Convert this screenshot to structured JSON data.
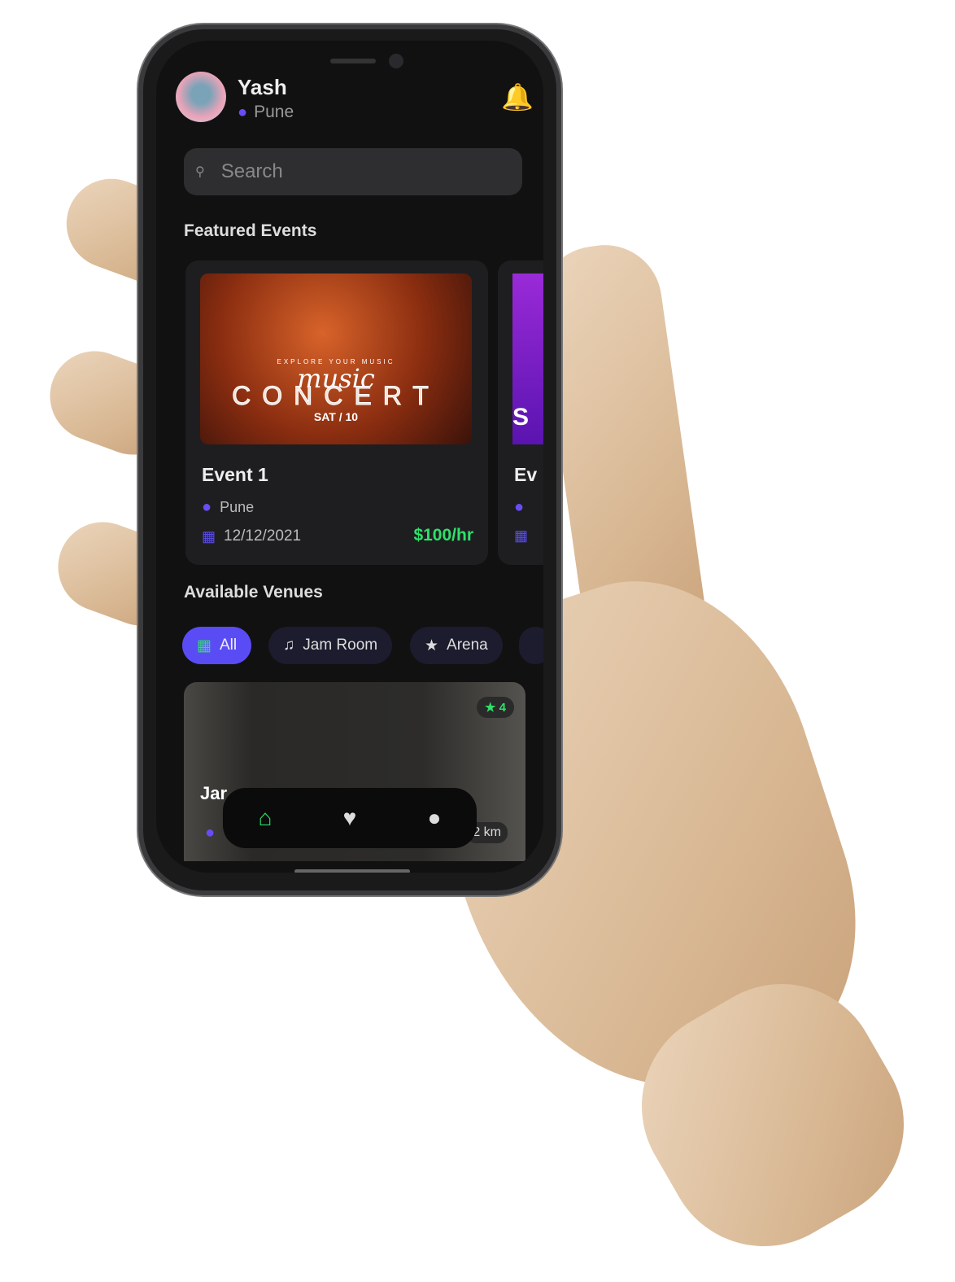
{
  "user": {
    "name": "Yash",
    "location": "Pune"
  },
  "search": {
    "placeholder": "Search"
  },
  "featured": {
    "title": "Featured Events",
    "events": [
      {
        "title": "Event 1",
        "location": "Pune",
        "date": "12/12/2021",
        "price": "$100/hr",
        "poster": {
          "tagline": "EXPLORE YOUR MUSIC",
          "script": "music",
          "headline": "CONCERT",
          "date": "SAT / 10"
        }
      },
      {
        "title": "Ev",
        "poster_letter": "S"
      }
    ]
  },
  "venues": {
    "title": "Available Venues",
    "filters": [
      {
        "label": "All",
        "icon": "grid-icon",
        "active": true
      },
      {
        "label": "Jam Room",
        "icon": "music-note-icon"
      },
      {
        "label": "Arena",
        "icon": "star-icon"
      }
    ],
    "items": [
      {
        "name": "Jar",
        "rating": "4",
        "distance": "2 km"
      }
    ]
  },
  "nav": {
    "items": [
      "home",
      "favorites",
      "profile"
    ],
    "active": "home"
  },
  "colors": {
    "accent": "#5a4cf5",
    "price": "#2fe06a",
    "background": "#111111"
  }
}
